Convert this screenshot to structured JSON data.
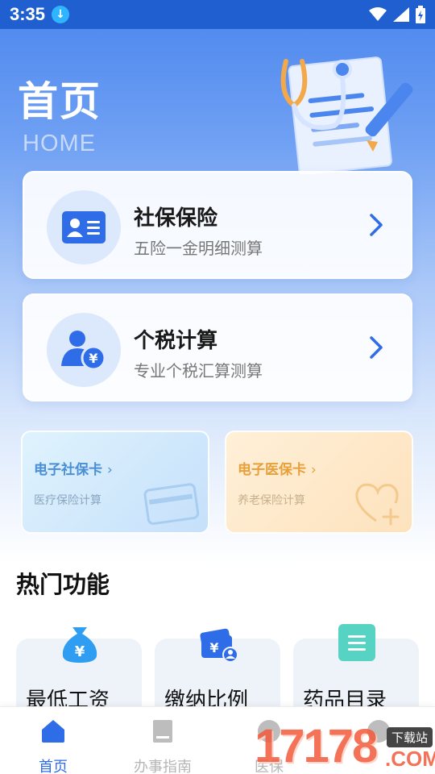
{
  "status_bar": {
    "time": "3:35",
    "download_glyph": "↓"
  },
  "header": {
    "title": "首页",
    "subtitle": "HOME"
  },
  "cards": [
    {
      "title": "社保保险",
      "subtitle": "五险一金明细测算",
      "icon": "id-card-icon"
    },
    {
      "title": "个税计算",
      "subtitle": "专业个税汇算测算",
      "icon": "user-yuan-icon"
    }
  ],
  "mini_cards": [
    {
      "title": "电子社保卡",
      "subtitle": "医疗保险计算",
      "chevron": "›",
      "color": "#4a8fd6"
    },
    {
      "title": "电子医保卡",
      "subtitle": "养老保险计算",
      "chevron": "›",
      "color": "#e8a03a"
    }
  ],
  "hot_section": {
    "title": "热门功能"
  },
  "functions": [
    {
      "label": "最低工资",
      "icon": "money-bag-icon"
    },
    {
      "label": "缴纳比例",
      "icon": "wallet-user-icon"
    },
    {
      "label": "药品目录",
      "icon": "document-list-icon"
    }
  ],
  "tab_bar": {
    "active_color": "#2f6ce8",
    "items": [
      {
        "label": "首页",
        "icon": "home-icon",
        "active": true
      },
      {
        "label": "办事指南",
        "icon": "book-icon",
        "active": false
      },
      {
        "label": "医保",
        "icon": "medical-icon",
        "active": false
      },
      {
        "label": "",
        "icon": "profile-icon",
        "active": false
      }
    ]
  },
  "watermark": {
    "number": "17178",
    "domain": ".COM",
    "tag": "下载站"
  }
}
